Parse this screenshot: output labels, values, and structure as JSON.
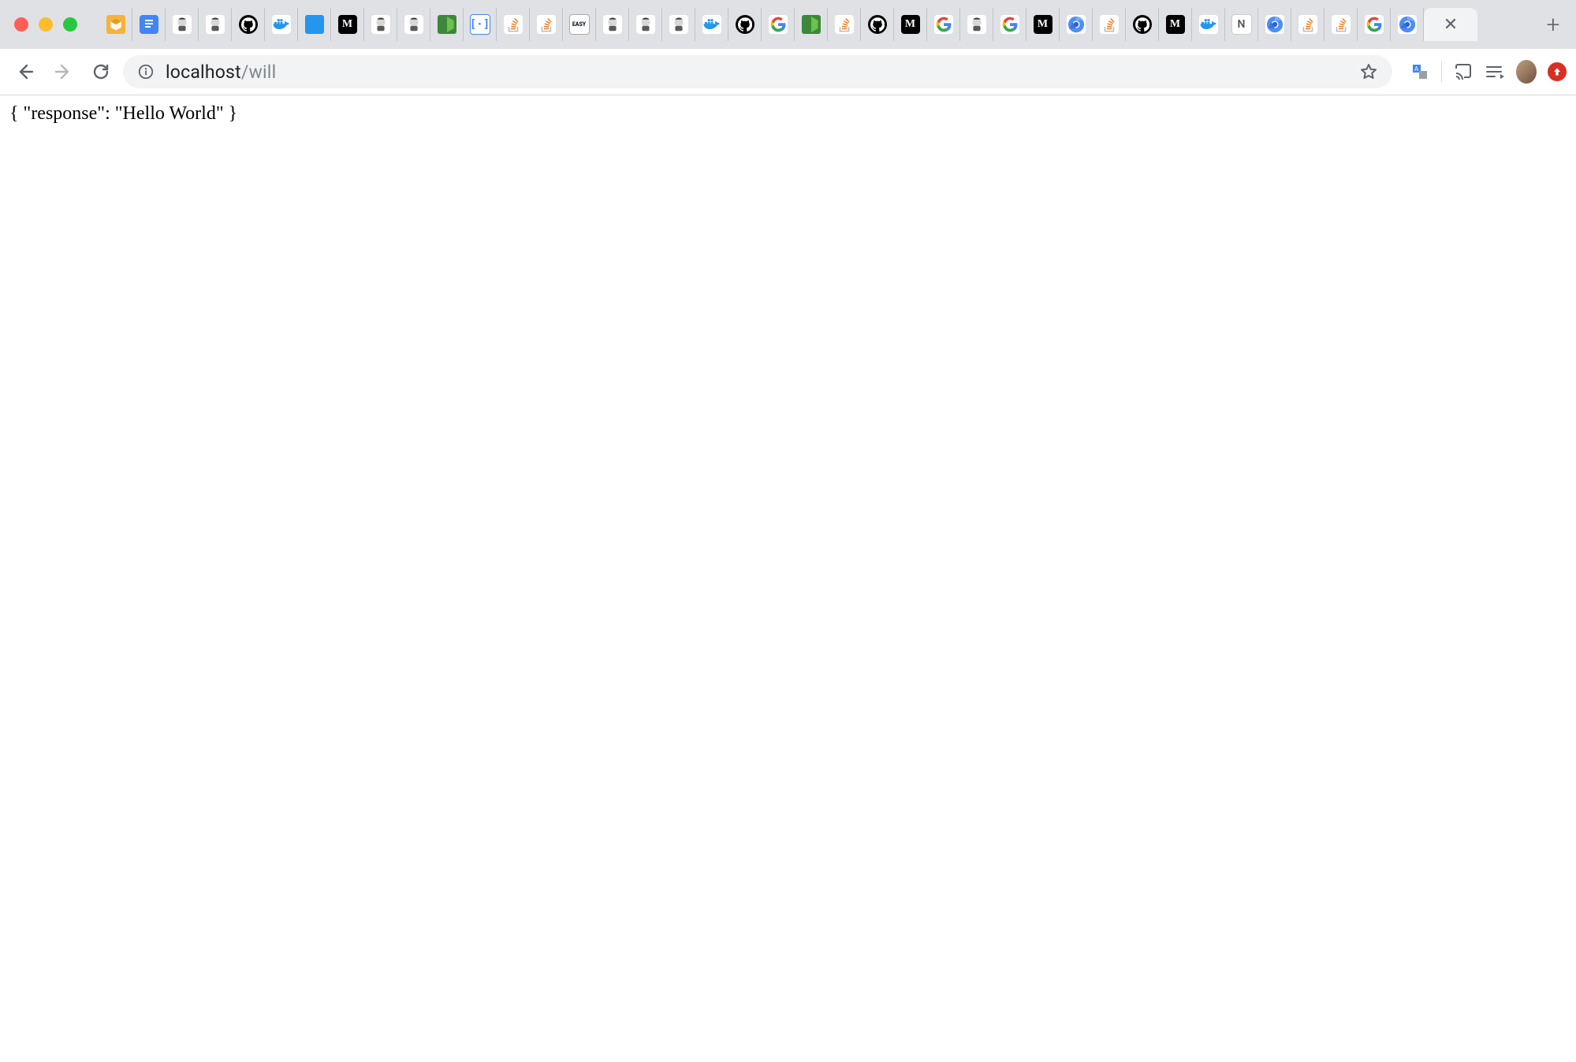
{
  "window": {
    "platform": "mac"
  },
  "tabs": [
    {
      "id": "t00",
      "kind": "box"
    },
    {
      "id": "t01",
      "kind": "docs"
    },
    {
      "id": "t02",
      "kind": "jenkins"
    },
    {
      "id": "t03",
      "kind": "jenkins"
    },
    {
      "id": "t04",
      "kind": "github"
    },
    {
      "id": "t05",
      "kind": "docker"
    },
    {
      "id": "t06",
      "kind": "dockerblue"
    },
    {
      "id": "t07",
      "kind": "medium"
    },
    {
      "id": "t08",
      "kind": "jenkins"
    },
    {
      "id": "t09",
      "kind": "jenkins"
    },
    {
      "id": "t10",
      "kind": "node"
    },
    {
      "id": "t11",
      "kind": "bracket"
    },
    {
      "id": "t12",
      "kind": "stack"
    },
    {
      "id": "t13",
      "kind": "stack"
    },
    {
      "id": "t14",
      "kind": "easy"
    },
    {
      "id": "t15",
      "kind": "jenkins"
    },
    {
      "id": "t16",
      "kind": "jenkins"
    },
    {
      "id": "t17",
      "kind": "jenkins"
    },
    {
      "id": "t18",
      "kind": "docker"
    },
    {
      "id": "t19",
      "kind": "github"
    },
    {
      "id": "t20",
      "kind": "google"
    },
    {
      "id": "t21",
      "kind": "node"
    },
    {
      "id": "t22",
      "kind": "stack"
    },
    {
      "id": "t23",
      "kind": "github"
    },
    {
      "id": "t24",
      "kind": "medium"
    },
    {
      "id": "t25",
      "kind": "google"
    },
    {
      "id": "t26",
      "kind": "jenkins"
    },
    {
      "id": "t27",
      "kind": "google"
    },
    {
      "id": "t28",
      "kind": "medium"
    },
    {
      "id": "t29",
      "kind": "chromium"
    },
    {
      "id": "t30",
      "kind": "stack"
    },
    {
      "id": "t31",
      "kind": "github"
    },
    {
      "id": "t32",
      "kind": "medium"
    },
    {
      "id": "t33",
      "kind": "docker"
    },
    {
      "id": "t34",
      "kind": "n"
    },
    {
      "id": "t35",
      "kind": "chromium"
    },
    {
      "id": "t36",
      "kind": "stack"
    },
    {
      "id": "t37",
      "kind": "stack"
    },
    {
      "id": "t38",
      "kind": "google"
    },
    {
      "id": "t39",
      "kind": "chromium"
    },
    {
      "id": "t40",
      "kind": "active",
      "active": true
    }
  ],
  "address_bar": {
    "url_host": "localhost",
    "url_path": "/will"
  },
  "extensions": {
    "translate_icon": "translate-icon",
    "cast_icon": "cast-icon",
    "playlist_icon": "playlist-icon",
    "avatar": "profile-avatar",
    "update_badge": "▲"
  },
  "page": {
    "body_text": "{ \"response\": \"Hello World\" }"
  },
  "glyphs": {
    "medium": "M",
    "n": "N",
    "bracket": "[·]",
    "easy": "EASY",
    "close_x": "✕",
    "plus": "+",
    "docs_lines": "≡"
  }
}
